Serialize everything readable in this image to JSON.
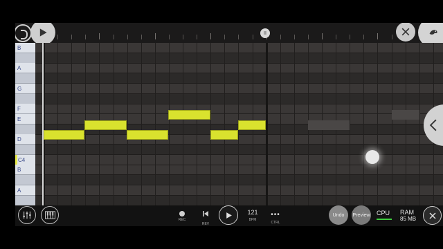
{
  "keyboard": {
    "keys": [
      {
        "label": "B",
        "shade": "light"
      },
      {
        "label": "",
        "shade": "dark"
      },
      {
        "label": "A",
        "shade": "light"
      },
      {
        "label": "",
        "shade": "dark"
      },
      {
        "label": "G",
        "shade": "light"
      },
      {
        "label": "",
        "shade": "dark"
      },
      {
        "label": "F",
        "shade": "light"
      },
      {
        "label": "E",
        "shade": "light"
      },
      {
        "label": "",
        "shade": "dark"
      },
      {
        "label": "D",
        "shade": "light"
      },
      {
        "label": "",
        "shade": "dark"
      },
      {
        "label": "C4",
        "shade": "light"
      },
      {
        "label": "B",
        "shade": "light"
      },
      {
        "label": "",
        "shade": "dark"
      },
      {
        "label": "A",
        "shade": "light"
      },
      {
        "label": "",
        "shade": "dark"
      }
    ]
  },
  "top": {
    "marker_label": "II"
  },
  "transport": {
    "rec_label": "REC",
    "rev_label": "REV",
    "bpm_value": "121",
    "bpm_label": "BPM",
    "ctrl_label": "CTRL",
    "ctrl_dots": "•••",
    "undo_label": "Undo",
    "preview_label": "Preview"
  },
  "status": {
    "cpu_label": "CPU",
    "ram_label": "RAM",
    "ram_value": "85 MB"
  },
  "colors": {
    "note": "#d9e22e",
    "grid_dark": "#2c2a29",
    "grid_light": "#3a3736",
    "cpu_meter": "#3fcf3f"
  },
  "icons": [
    "app-logo-icon",
    "play-icon",
    "close-icon",
    "bird-icon",
    "chevron-left-icon",
    "mixer-icon",
    "piano-icon",
    "record-icon",
    "rewind-icon"
  ]
}
